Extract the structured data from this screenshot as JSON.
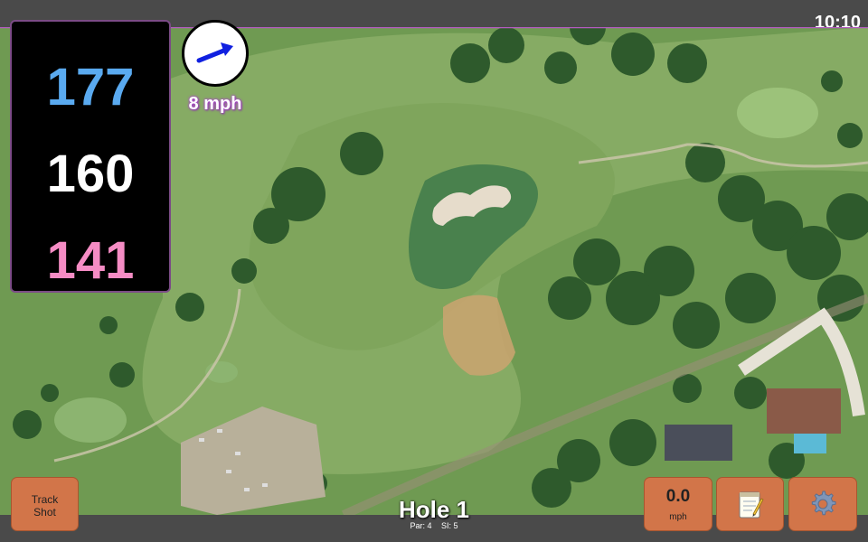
{
  "status_bar": {
    "time": "10:10"
  },
  "yardages": {
    "back": "177",
    "middle": "160",
    "front": "141"
  },
  "wind": {
    "speed": "8 mph",
    "arrow_icon": "arrow-right-up-icon",
    "arrow_color": "#1020e0"
  },
  "buttons": {
    "track_shot_line1": "Track",
    "track_shot_line2": "Shot",
    "speed_value": "0.0",
    "speed_unit": "mph",
    "notes_icon": "notepad-icon",
    "settings_icon": "gear-icon"
  },
  "hole": {
    "title": "Hole 1",
    "par": "Par: 4",
    "si": "SI: 5"
  },
  "colors": {
    "back_yardage": "#5aaaf0",
    "middle_yardage": "#ffffff",
    "front_yardage": "#f58cc4",
    "button_bg": "#d27549",
    "panel_border": "#7b4b86"
  }
}
